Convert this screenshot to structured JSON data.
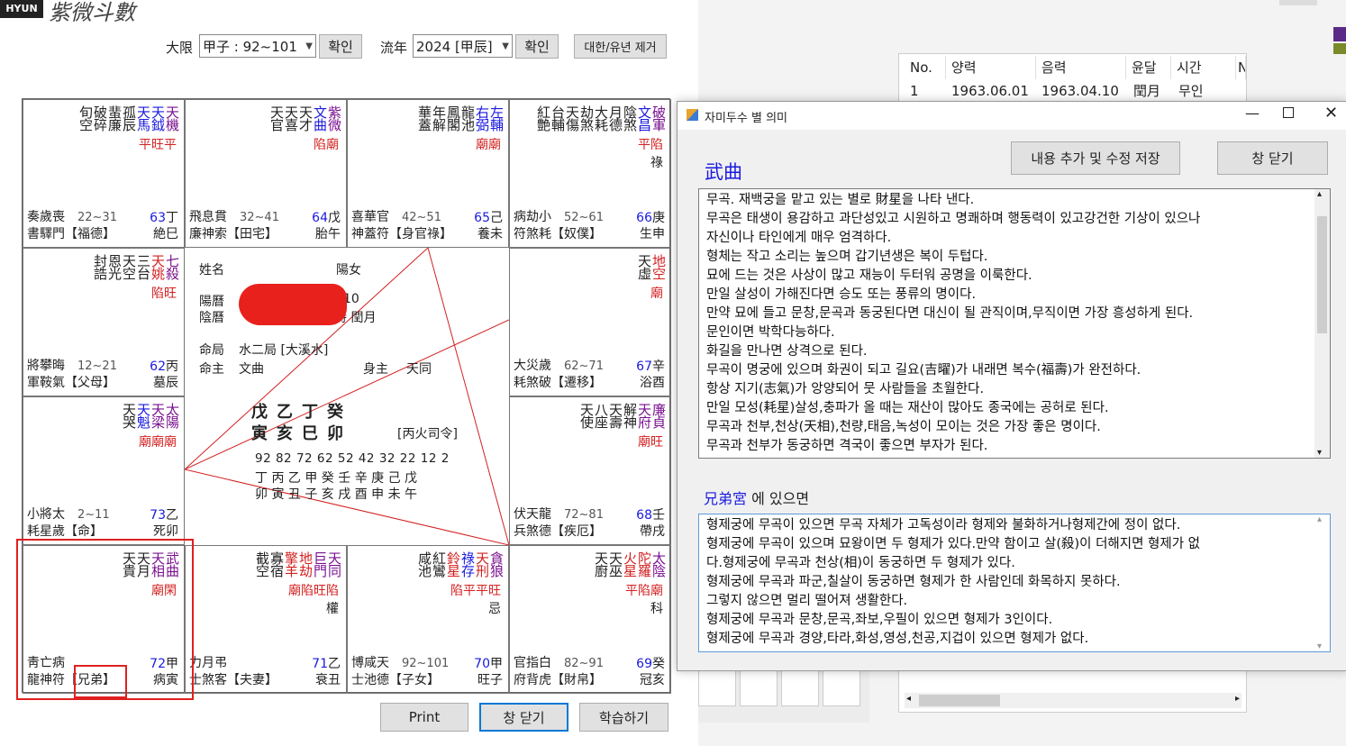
{
  "app": {
    "logo_badge": "HYUN",
    "logo_calligraphy": "紫微斗數"
  },
  "controls": {
    "daehan_label": "大限",
    "daehan_value": "甲子 : 92~101",
    "confirm1": "확인",
    "yunyear_label": "流年",
    "yunyear_value": "2024 [甲辰]",
    "confirm2": "확인",
    "remove_btn": "대한/유년 제거"
  },
  "palaces": [
    {
      "stars": [
        {
          "t": "天機",
          "c": "purple"
        },
        {
          "t": "天鉞",
          "c": "blue"
        },
        {
          "t": "天馬",
          "c": "blue"
        },
        {
          "t": "孤辰"
        },
        {
          "t": "蜚廉"
        },
        {
          "t": "破碎"
        },
        {
          "t": "旬空"
        }
      ],
      "bright": "平旺平",
      "hua": "",
      "l1": "奏歲喪",
      "l2": "書驛門【福德】",
      "ages": "22~31",
      "r1n": "63",
      "r1s": "丁",
      "r2": "絶巳"
    },
    {
      "stars": [
        {
          "t": "紫微",
          "c": "purple"
        },
        {
          "t": "文曲",
          "c": "blue"
        },
        {
          "t": "天才"
        },
        {
          "t": "天喜"
        },
        {
          "t": "天官"
        }
      ],
      "bright": "陷廟",
      "hua": "",
      "l1": "飛息貫",
      "l2": "廉神索【田宅】",
      "ages": "32~41",
      "r1n": "64",
      "r1s": "戊",
      "r2": "胎午"
    },
    {
      "stars": [
        {
          "t": "左輔",
          "c": "blue"
        },
        {
          "t": "右弼",
          "c": "blue"
        },
        {
          "t": "龍池"
        },
        {
          "t": "鳳閣"
        },
        {
          "t": "年解"
        },
        {
          "t": "華蓋"
        }
      ],
      "bright": "廟廟",
      "hua": "",
      "l1": "喜華官",
      "l2": "神蓋符【身官祿】",
      "ages": "42~51",
      "r1n": "65",
      "r1s": "己",
      "r2": "養未"
    },
    {
      "stars": [
        {
          "t": "破軍",
          "c": "purple"
        },
        {
          "t": "文昌",
          "c": "blue"
        },
        {
          "t": "陰煞"
        },
        {
          "t": "月德"
        },
        {
          "t": "大耗"
        },
        {
          "t": "劫煞"
        },
        {
          "t": "天傷"
        },
        {
          "t": "台輔"
        },
        {
          "t": "紅艶"
        }
      ],
      "bright": "平陷",
      "hua": "祿",
      "l1": "病劫小",
      "l2": "符煞耗【奴僕】",
      "ages": "52~61",
      "r1n": "66",
      "r1s": "庚",
      "r2": "生申"
    },
    {
      "stars": [
        {
          "t": "七殺",
          "c": "purple"
        },
        {
          "t": "天姚",
          "c": "red"
        },
        {
          "t": "三台"
        },
        {
          "t": "天空"
        },
        {
          "t": "恩光"
        },
        {
          "t": "封誥"
        }
      ],
      "bright": "陷旺",
      "hua": "",
      "l1": "將攀晦",
      "l2": "軍鞍氣【父母】",
      "ages": "12~21",
      "r1n": "62",
      "r1s": "丙",
      "r2": "墓辰"
    },
    {
      "stars": [
        {
          "t": "地空",
          "c": "red"
        },
        {
          "t": "天虛"
        }
      ],
      "bright": "廟",
      "hua": "",
      "l1": "大災歲",
      "l2": "耗煞破【遷移】",
      "ages": "62~71",
      "r1n": "67",
      "r1s": "辛",
      "r2": "浴酉"
    },
    {
      "stars": [
        {
          "t": "太陽",
          "c": "purple"
        },
        {
          "t": "天梁",
          "c": "purple"
        },
        {
          "t": "天魁",
          "c": "blue"
        },
        {
          "t": "天哭"
        }
      ],
      "bright": "廟廟廟",
      "hua": "",
      "l1": "小將太",
      "l2": "耗星歲【命】",
      "ages": "2~11",
      "r1n": "73",
      "r1s": "乙",
      "r2": "死卯"
    },
    {
      "stars": [
        {
          "t": "廉貞",
          "c": "purple"
        },
        {
          "t": "天府",
          "c": "purple"
        },
        {
          "t": "解神"
        },
        {
          "t": "天壽"
        },
        {
          "t": "八座"
        },
        {
          "t": "天使"
        }
      ],
      "bright": "廟旺",
      "hua": "",
      "l1": "伏天龍",
      "l2": "兵煞德【疾厄】",
      "ages": "72~81",
      "r1n": "68",
      "r1s": "壬",
      "r2": "帶戌"
    },
    {
      "stars": [
        {
          "t": "武曲",
          "c": "purple"
        },
        {
          "t": "天相",
          "c": "purple"
        },
        {
          "t": "天月"
        },
        {
          "t": "天貴"
        }
      ],
      "bright": "廟閑",
      "hua": "",
      "l1": "靑亡病",
      "l2": "龍神符【兄弟】",
      "ages": "",
      "r1n": "72",
      "r1s": "甲",
      "r2": "病寅"
    },
    {
      "stars": [
        {
          "t": "天同",
          "c": "purple"
        },
        {
          "t": "巨門",
          "c": "purple"
        },
        {
          "t": "地劫",
          "c": "red"
        },
        {
          "t": "擎羊",
          "c": "red"
        },
        {
          "t": "寡宿"
        },
        {
          "t": "截空"
        }
      ],
      "bright": "廟陷旺陷",
      "hua": "權",
      "l1": "力月弔",
      "l2": "士煞客【夫妻】",
      "ages": "",
      "r1n": "71",
      "r1s": "乙",
      "r2": "衰丑"
    },
    {
      "stars": [
        {
          "t": "貪狼",
          "c": "purple"
        },
        {
          "t": "天刑",
          "c": "red"
        },
        {
          "t": "祿存",
          "c": "blue"
        },
        {
          "t": "鈴星",
          "c": "red"
        },
        {
          "t": "紅鸞"
        },
        {
          "t": "咸池"
        }
      ],
      "bright": "陷平平旺",
      "hua": "忌",
      "l1": "博咸天",
      "l2": "士池德【子女】",
      "ages": "92~101",
      "r1n": "70",
      "r1s": "甲",
      "r2": "旺子"
    },
    {
      "stars": [
        {
          "t": "太陰",
          "c": "purple"
        },
        {
          "t": "陀羅",
          "c": "red"
        },
        {
          "t": "火星",
          "c": "red"
        },
        {
          "t": "天巫"
        },
        {
          "t": "天廚"
        }
      ],
      "bright": "平陷廟",
      "hua": "科",
      "l1": "官指白",
      "l2": "府背虎【財帛】",
      "ages": "82~91",
      "r1n": "69",
      "r1s": "癸",
      "r2": "冠亥"
    }
  ],
  "center": {
    "name_label": "姓名",
    "gender": "陽女",
    "solar_label": "陽曆",
    "solar_tail": "10",
    "lunar_label": "陰曆",
    "lunar_tail": "寅時  閏月",
    "bureau_label": "命局",
    "bureau_value": "水二局 [大溪水]",
    "ming_label": "命主",
    "ming_value": "文曲",
    "shen_label": "身主",
    "shen_value": "天同",
    "stems": "戊乙丁癸",
    "branches": "寅亥巳卯",
    "siling": "[丙火司令]",
    "daehan_ages": "92 82 72 62 52 42 32 22 12  2",
    "daehan_stems": "丁 丙 乙 甲 癸 壬 辛 庚 己 戊",
    "daehan_branches": "卯 寅 丑 子 亥 戌 酉 申 未 午"
  },
  "bottom_buttons": {
    "print": "Print",
    "close": "창 닫기",
    "learn": "학습하기"
  },
  "table": {
    "headers": [
      "No.",
      "양력",
      "음력",
      "윤달",
      "시간",
      "N"
    ],
    "rows": [
      [
        "1",
        "1963.06.01",
        "1963.04.10",
        "閏月",
        "무인"
      ]
    ]
  },
  "dialog": {
    "title": "자미두수 별 의미",
    "save_btn": "내용 추가 및 수정 저장",
    "close_btn": "창 닫기",
    "star_name": "武曲",
    "meaning_lines": [
      "무곡. 재백궁을 맡고 있는 별로 財星을 나타 낸다.",
      "무곡은 태생이 용감하고 과단성있고 시원하고 명쾌하며 행동력이 있고강건한 기상이 있으나",
      "자신이나 타인에게 매우 엄격하다.",
      "형체는 작고 소리는 높으며 갑기년생은 복이 두텁다.",
      "묘에 드는 것은 사상이 많고 재능이 두터워 공명을 이룩한다.",
      "만일 살성이 가해진다면 승도 또는 풍류의 명이다.",
      "만약 묘에 들고 문창,문곡과 동궁된다면 대신이 될 관직이며,무직이면 가장 흥성하게 된다.",
      "문인이면 박학다능하다.",
      "화길을 만나면 상격으로 된다.",
      "무곡이 명궁에 있으며 화권이 되고 길요(吉曜)가 내래면 복수(福壽)가 완전하다.",
      "항상 지기(志氣)가 앙양되어 뭇 사람들을 초월한다.",
      "만일 모성(耗星)살성,충파가 올 때는 재산이 많아도 종국에는 공허로 된다.",
      "무곡과 천부,천상(天相),천량,태음,녹성이 모이는 것은 가장 좋은 명이다.",
      "무곡과 천부가 동궁하면 격국이 좋으면 부자가 된다."
    ],
    "palace_name": "兄弟宮",
    "palace_suffix": "에 있으면",
    "palace_lines": [
      "형제궁에 무곡이 있으면 무곡 자체가 고독성이라 형제와 불화하거나형제간에 정이 없다.",
      "형제궁에 무곡이 있으며 묘왕이면 두 형제가 있다.만약 함이고 살(殺)이 더해지면 형제가 없",
      "다.형제궁에 무곡과 천상(相)이 동궁하면 두 형제가 있다.",
      "형제궁에 무곡과 파군,칠살이 동궁하면 형제가 한 사람인데 화목하지 못하다.",
      "그렇지 않으면 멀리 떨어져 생활한다.",
      "형제궁에 무곡과 문창,문곡,좌보,우필이 있으면 형제가 3인이다.",
      "형제궁에 무곡과 경양,타라,화성,영성,천공,지겁이 있으면 형제가 없다."
    ]
  }
}
